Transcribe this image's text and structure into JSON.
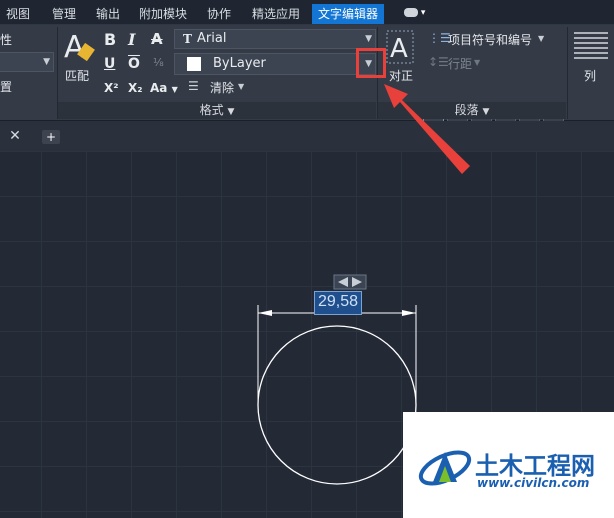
{
  "menu": {
    "tabs": [
      "视图",
      "管理",
      "输出",
      "附加模块",
      "协作",
      "精选应用",
      "文字编辑器"
    ],
    "active": "文字编辑器"
  },
  "ribbon": {
    "left_cut_label1": "性",
    "left_cut_label2": "置",
    "match_label": "匹配",
    "font_name": "Arial",
    "color_name": "ByLayer",
    "clear_label": "清除",
    "format_footer": "格式",
    "justify_label": "对正",
    "bullets_label": "项目符号和编号",
    "spacing_label": "行距",
    "paragraph_footer": "段落",
    "columns_label": "列",
    "bold": "B",
    "italic": "I",
    "strike": "A",
    "underline": "U",
    "overline": "O",
    "superscript": "X²",
    "subscript": "X₂",
    "case": "Aa"
  },
  "canvas": {
    "dimension_value": "29,58"
  },
  "watermark": {
    "brand": "土木工程网",
    "url": "www.civilcn.com"
  },
  "colors": {
    "accent": "#1476d4",
    "highlight": "#e8403a",
    "watermark_blue": "#1b5fb0"
  }
}
